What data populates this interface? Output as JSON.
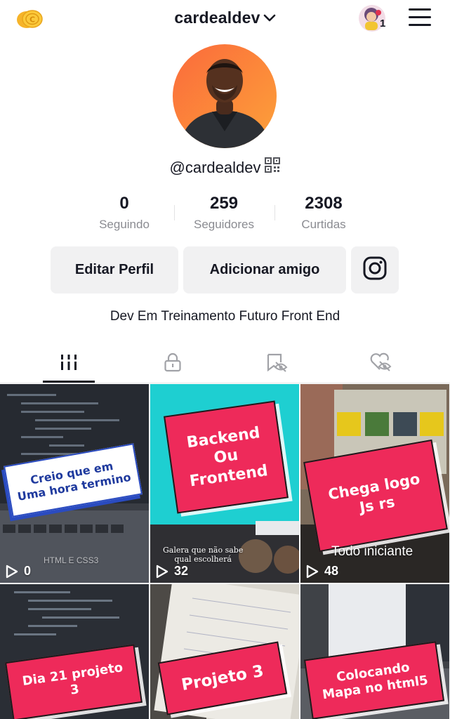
{
  "header": {
    "username": "cardealdev",
    "friend_requests_count": "1"
  },
  "profile": {
    "handle": "@cardealdev",
    "bio": "Dev Em Treinamento Futuro Front End"
  },
  "stats": [
    {
      "value": "0",
      "label": "Seguindo"
    },
    {
      "value": "259",
      "label": "Seguidores"
    },
    {
      "value": "2308",
      "label": "Curtidas"
    }
  ],
  "buttons": {
    "edit_profile": "Editar Perfil",
    "add_friend": "Adicionar amigo"
  },
  "tabs": [
    {
      "icon": "videos-grid-icon",
      "active": true
    },
    {
      "icon": "lock-icon",
      "active": false
    },
    {
      "icon": "bookmark-eye-icon",
      "active": false
    },
    {
      "icon": "heart-eye-icon",
      "active": false
    }
  ],
  "videos": [
    {
      "caption": "Creio que em\nUma hora termino",
      "views": "0",
      "overlay": "HTML E CSS3"
    },
    {
      "caption": "Backend\nOu\nFrontend",
      "views": "32",
      "overlay": "Galera que não sabe\nqual escolherá"
    },
    {
      "caption": "Chega logo\nJs rs",
      "views": "48",
      "overlay": "Todo iniciante"
    },
    {
      "caption": "Dia 21 projeto\n3",
      "views": ""
    },
    {
      "caption": "Projeto 3",
      "views": ""
    },
    {
      "caption": "Colocando\nMapa no html5",
      "views": ""
    }
  ],
  "colors": {
    "accent_red": "#ee2a5a",
    "text_primary": "#161823",
    "text_secondary": "#8a8b91",
    "button_bg": "#f1f1f2"
  }
}
